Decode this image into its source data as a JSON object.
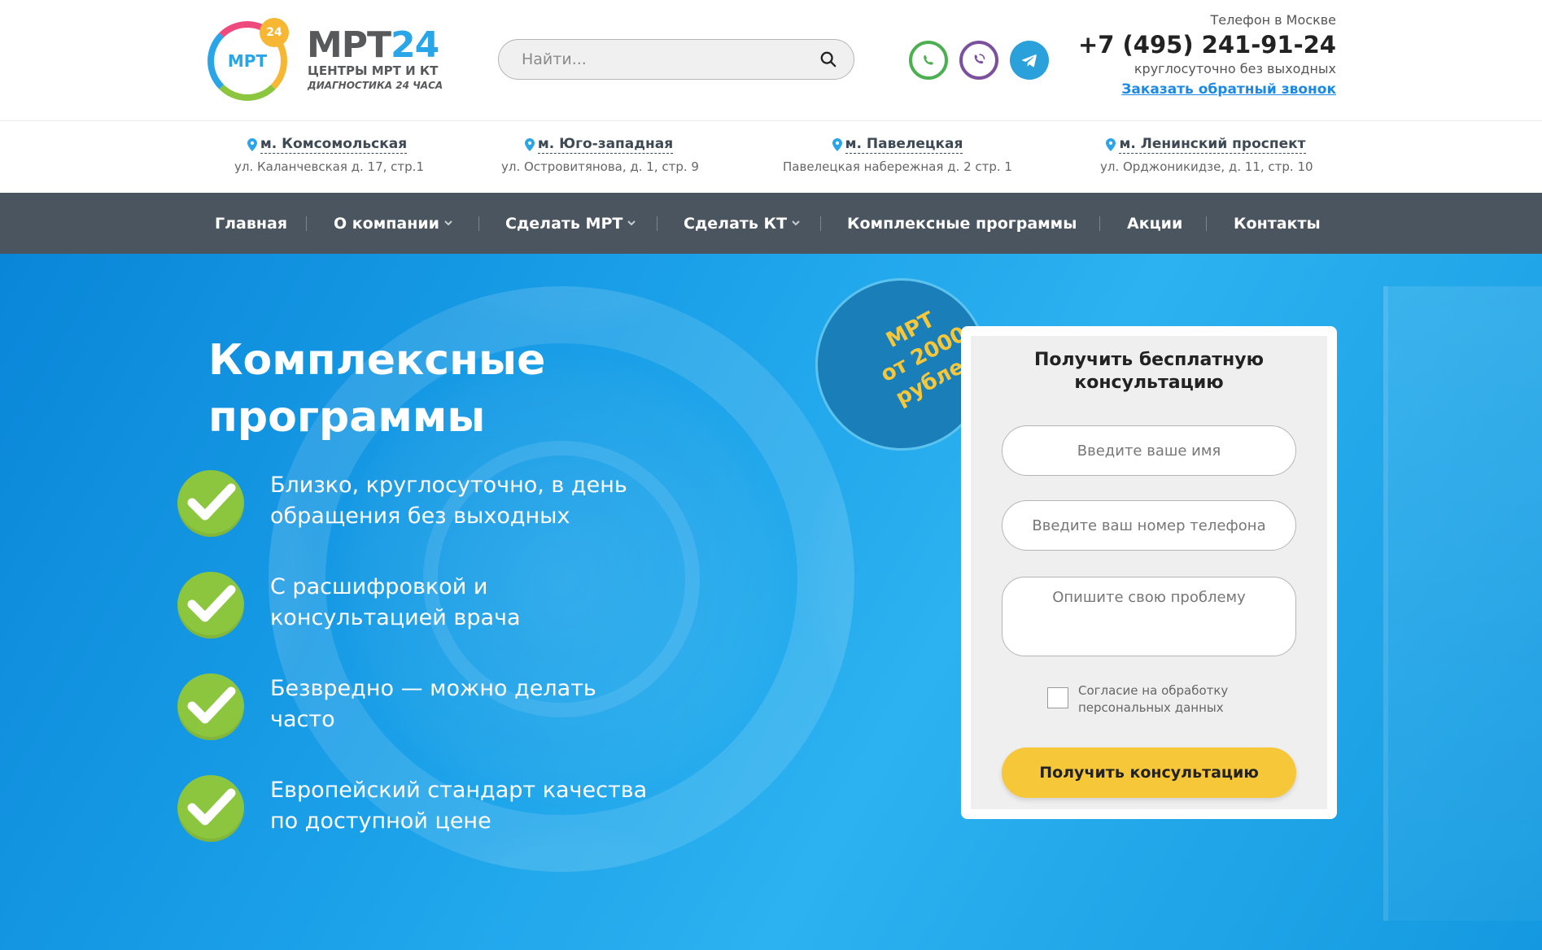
{
  "header": {
    "logo": {
      "ring_text": "МРТ",
      "badge": "24",
      "title_main": "МРТ",
      "title_accent": "24",
      "subtitle": "ЦЕНТРЫ МРТ И КТ",
      "tagline": "ДИАГНОСТИКА 24 ЧАСА"
    },
    "search": {
      "placeholder": "Найти..."
    },
    "messengers": [
      "whatsapp-icon",
      "viber-icon",
      "telegram-icon"
    ],
    "phone": {
      "label": "Телефон в Москве",
      "number": "+7 (495) 241-91-24",
      "hours": "круглосуточно без выходных",
      "callback": "Заказать обратный звонок"
    }
  },
  "locations": [
    {
      "station": "м. Комсомольская",
      "address": "ул. Каланчевская д. 17, стр.1"
    },
    {
      "station": "м. Юго-западная",
      "address": "ул. Островитянова, д. 1, стр. 9"
    },
    {
      "station": "м. Павелецкая",
      "address": "Павелецкая набережная д. 2 стр. 1"
    },
    {
      "station": "м. Ленинский проспект",
      "address": "ул. Орджоникидзе, д. 11, стр. 10"
    }
  ],
  "nav": {
    "items": [
      {
        "label": "Главная",
        "dropdown": false
      },
      {
        "label": "О компании",
        "dropdown": true
      },
      {
        "label": "Сделать МРТ",
        "dropdown": true
      },
      {
        "label": "Сделать КТ",
        "dropdown": true
      },
      {
        "label": "Комплексные программы",
        "dropdown": false
      },
      {
        "label": "Акции",
        "dropdown": false
      },
      {
        "label": "Контакты",
        "dropdown": false
      }
    ]
  },
  "hero": {
    "title_line1": "Комплексные",
    "title_line2": "программы",
    "benefits": [
      {
        "line1": "Близко, круглосуточно, в день",
        "line2": "обращения без выходных"
      },
      {
        "line1": "С расшифровкой и",
        "line2": "консультацией врача"
      },
      {
        "line1": "Безвредно — можно делать",
        "line2": "часто"
      },
      {
        "line1": "Европейский стандарт качества",
        "line2": "по доступной цене"
      }
    ],
    "promo": {
      "line1": "МРТ",
      "line2": "от 2000",
      "line3": "рублей"
    }
  },
  "form": {
    "title_line1": "Получить бесплатную",
    "title_line2": "консультацию",
    "name_placeholder": "Введите ваше имя",
    "phone_placeholder": "Введите ваш номер телефона",
    "problem_placeholder": "Опишите свою проблему",
    "consent_line1": "Согласие на обработку",
    "consent_line2": "персональных данных",
    "submit_label": "Получить консультацию"
  },
  "colors": {
    "nav_bg": "#4a5560",
    "hero_blue": "#1aa0e8",
    "accent_yellow": "#f7c73a",
    "check_green": "#8cc63f",
    "link_blue": "#1e88e5"
  }
}
